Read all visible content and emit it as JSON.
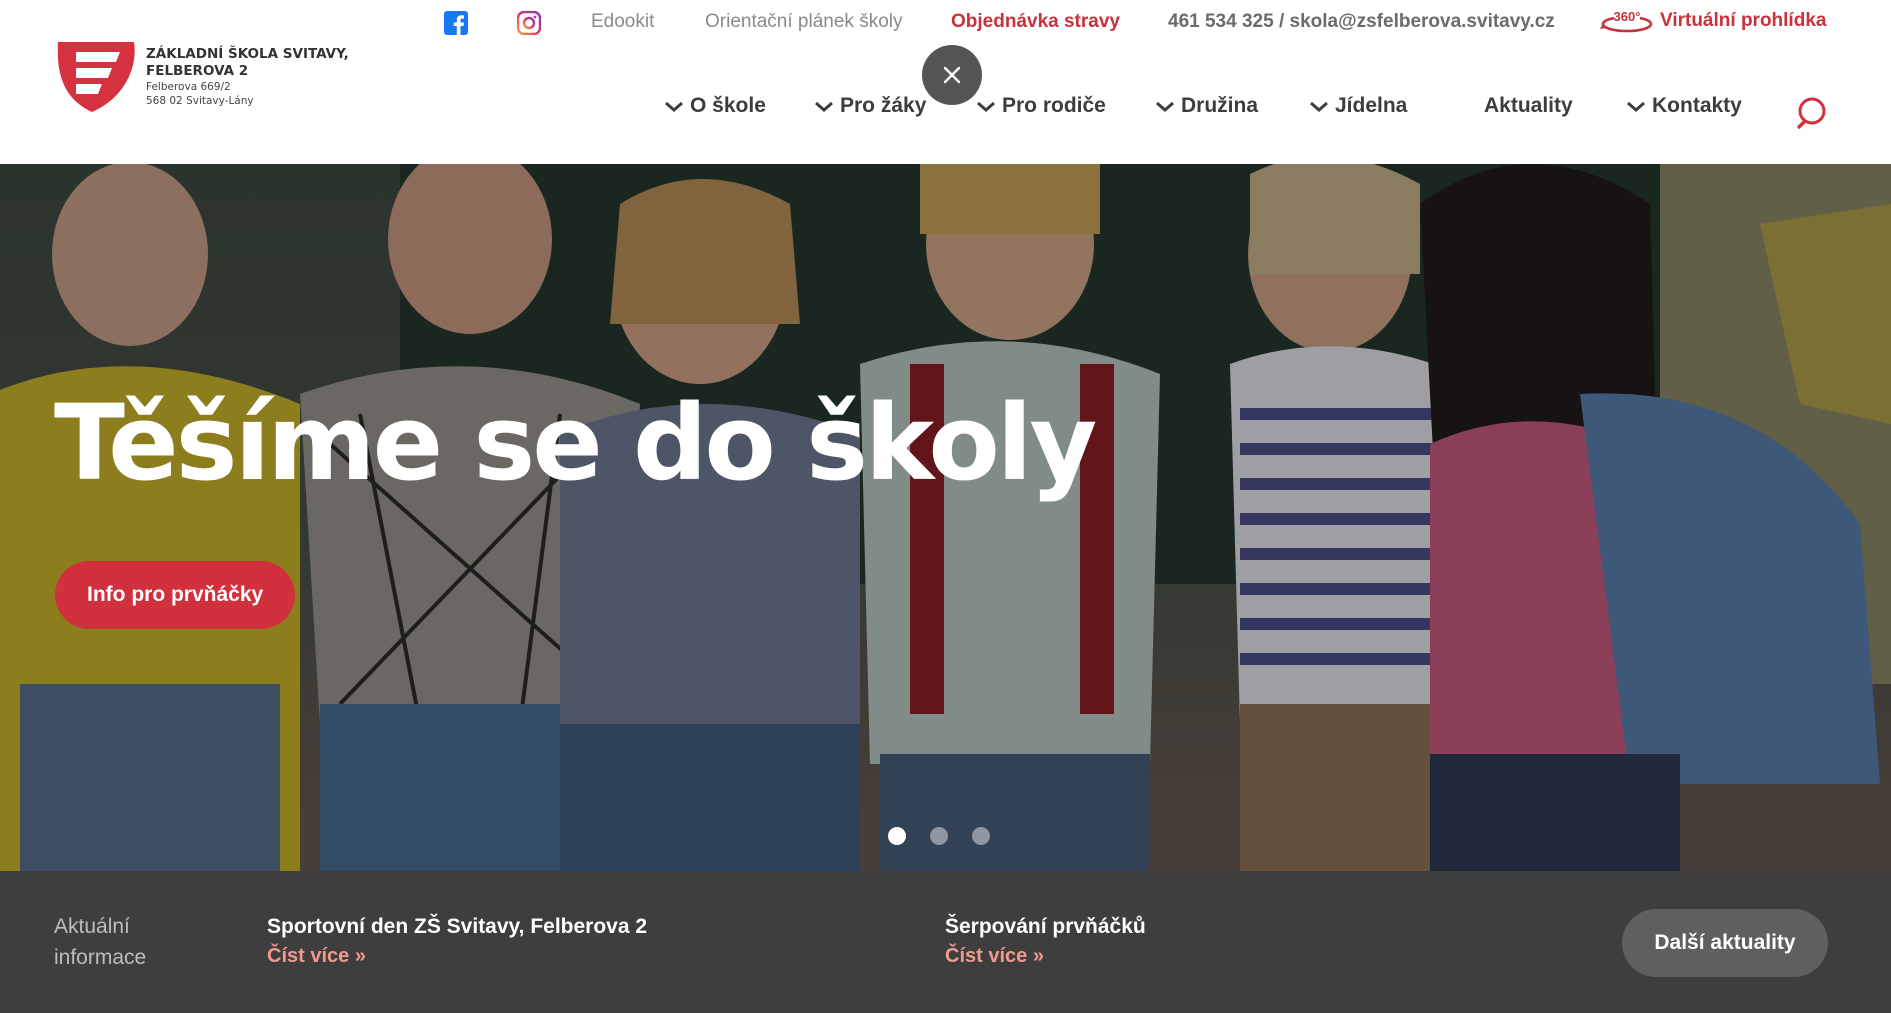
{
  "colors": {
    "brand_red": "#d1303d",
    "link_red": "#c9313c",
    "news_bg": "#3e3e3e",
    "read_more": "#f09a8e"
  },
  "logo": {
    "name": "ZÁKLADNÍ ŠKOLA SVITAVY, FELBEROVA 2",
    "address_line1": "Felberova 669/2",
    "address_line2": "568 02 Svitavy-Lány",
    "icon": "school-logo-mark"
  },
  "topbar": {
    "facebook_icon": "facebook-icon",
    "instagram_icon": "instagram-icon",
    "edookit": "Edookit",
    "school_map": "Orientační plánek školy",
    "food_order": "Objednávka stravy",
    "contact": "461 534 325 / skola@zsfelberova.svitavy.cz",
    "virtual_tour_badge": "360°",
    "virtual_tour": "Virtuální prohlídka"
  },
  "nav": {
    "items": [
      {
        "label": "O škole",
        "dropdown": true
      },
      {
        "label": "Pro žáky",
        "dropdown": true
      },
      {
        "label": "Pro rodiče",
        "dropdown": true
      },
      {
        "label": "Družina",
        "dropdown": true
      },
      {
        "label": "Jídelna",
        "dropdown": true
      },
      {
        "label": "Aktuality",
        "dropdown": false
      },
      {
        "label": "Kontakty",
        "dropdown": true
      }
    ],
    "search_icon": "search-icon",
    "close_icon": "close-icon"
  },
  "hero": {
    "title": "Těšíme se do školy",
    "button": "Info pro prvňáčky",
    "slides_total": 3,
    "active_slide": 1
  },
  "news": {
    "label": "Aktuální informace",
    "items": [
      {
        "title": "Sportovní den ZŠ Svitavy, Felberova 2",
        "more": "Číst více »"
      },
      {
        "title": "Šerpování prvňáčků",
        "more": "Číst více »"
      }
    ],
    "more_button": "Další aktuality"
  }
}
